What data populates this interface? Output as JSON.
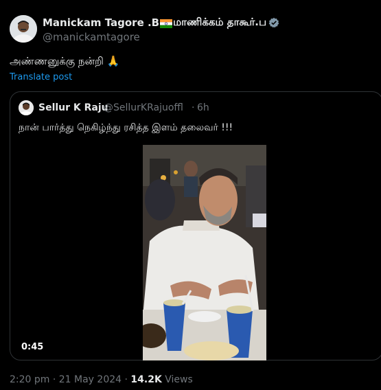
{
  "post": {
    "author": {
      "name_prefix": "Manickam Tagore .B",
      "flag_icon": "india-flag-icon",
      "name_suffix": "மாணிக்கம் தாகூர்.ப",
      "verified_icon": "verified-badge-icon",
      "handle": "@manickamtagore"
    },
    "text": "அண்ணனுக்கு நன்றி 🙏",
    "translate_label": "Translate post",
    "quote": {
      "author_name": "Sellur K Raju",
      "handle": "@SellurKRajuoffl",
      "separator": "·",
      "time": "6h",
      "text": "நான் பார்த்து நெகிழ்ந்து ரசித்த இளம் தலைவர் !!!",
      "video_duration": "0:45"
    },
    "meta": {
      "timestamp": "2:20 pm · 21 May 2024 · ",
      "views_count": "14.2K",
      "views_label": " Views"
    }
  },
  "colors": {
    "background": "#000000",
    "text_primary": "#e7e9ea",
    "text_secondary": "#71767b",
    "link": "#1d9bf0",
    "border": "#2f3336",
    "verified": "#829aab"
  }
}
